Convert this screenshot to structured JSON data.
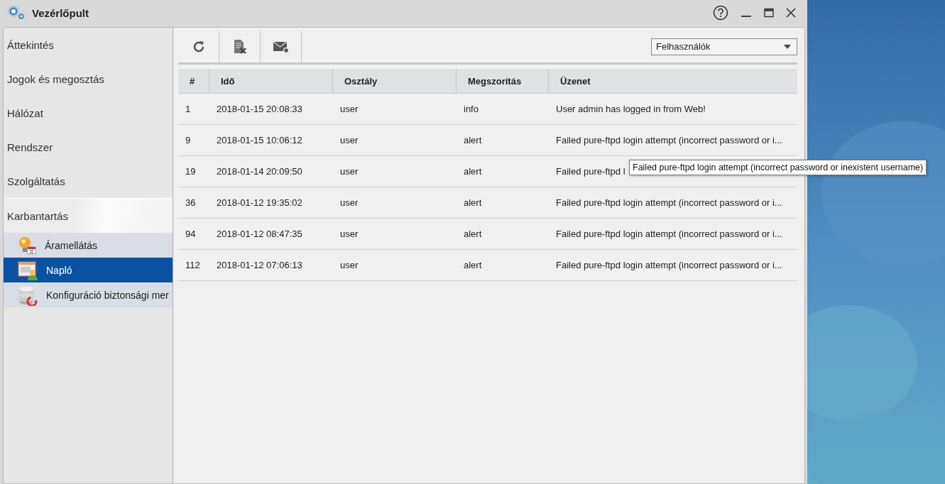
{
  "window": {
    "title": "Vezérlőpult"
  },
  "sidebar": {
    "items": [
      {
        "label": "Áttekintés",
        "expanded": false
      },
      {
        "label": "Jogok és megosztás",
        "expanded": false
      },
      {
        "label": "Hálózat",
        "expanded": false
      },
      {
        "label": "Rendszer",
        "expanded": false
      },
      {
        "label": "Szolgáltatás",
        "expanded": false
      },
      {
        "label": "Karbantartás",
        "expanded": true,
        "children": [
          {
            "label": "Áramellátás",
            "kind": "power",
            "selected": false
          },
          {
            "label": "Napló",
            "kind": "log",
            "selected": true
          },
          {
            "label": "Konfiguráció biztonsági mer",
            "kind": "backup",
            "selected": false
          }
        ]
      }
    ]
  },
  "toolbar": {
    "filter": {
      "value": "Felhasználók"
    }
  },
  "table": {
    "columns": [
      "#",
      "Idő",
      "Osztály",
      "Megszorítás",
      "Üzenet"
    ],
    "rows": [
      [
        "1",
        "2018-01-15 20:08:33",
        "user",
        "info",
        "User admin has logged in from Web!"
      ],
      [
        "9",
        "2018-01-15 10:06:12",
        "user",
        "alert",
        "Failed pure-ftpd login attempt (incorrect password or i..."
      ],
      [
        "19",
        "2018-01-14 20:09:50",
        "user",
        "alert",
        "Failed pure-ftpd l"
      ],
      [
        "36",
        "2018-01-12 19:35:02",
        "user",
        "alert",
        "Failed pure-ftpd login attempt (incorrect password or i..."
      ],
      [
        "94",
        "2018-01-12 08:47:35",
        "user",
        "alert",
        "Failed pure-ftpd login attempt (incorrect password or i..."
      ],
      [
        "112",
        "2018-01-12 07:06:13",
        "user",
        "alert",
        "Failed pure-ftpd login attempt (incorrect password or i..."
      ]
    ]
  },
  "tooltip": {
    "text": "Failed pure-ftpd login attempt (incorrect password or inexistent username)"
  }
}
